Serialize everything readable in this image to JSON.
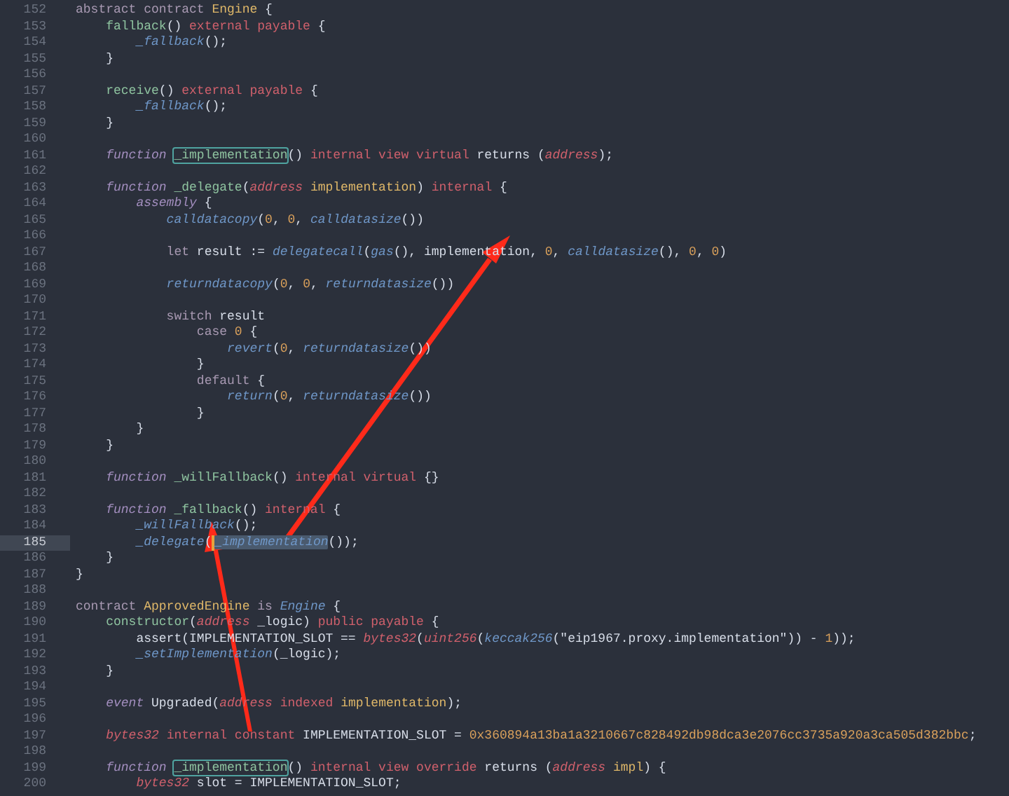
{
  "editor": {
    "lines": [
      {
        "number": "152",
        "current": false,
        "segments": [
          {
            "text": "abstract contract ",
            "kind": "control"
          },
          {
            "text": "Engine",
            "kind": "type"
          },
          {
            "text": " {",
            "kind": "plain"
          }
        ]
      },
      {
        "number": "153",
        "current": false,
        "segments": [
          {
            "text": "    fallback",
            "kind": "function"
          },
          {
            "text": "() ",
            "kind": "plain"
          },
          {
            "text": "external payable",
            "kind": "modifier"
          },
          {
            "text": " {",
            "kind": "plain"
          }
        ]
      },
      {
        "number": "154",
        "current": false,
        "segments": [
          {
            "text": "        _fallback",
            "kind": "call"
          },
          {
            "text": "();",
            "kind": "plain"
          }
        ]
      },
      {
        "number": "155",
        "current": false,
        "segments": [
          {
            "text": "    }",
            "kind": "plain"
          }
        ]
      },
      {
        "number": "156",
        "current": false
      },
      {
        "number": "157",
        "current": false,
        "segments": [
          {
            "text": "    receive",
            "kind": "function"
          },
          {
            "text": "() ",
            "kind": "plain"
          },
          {
            "text": "external payable",
            "kind": "modifier"
          },
          {
            "text": " {",
            "kind": "plain"
          }
        ]
      },
      {
        "number": "158",
        "current": false,
        "segments": [
          {
            "text": "        _fallback",
            "kind": "call"
          },
          {
            "text": "();",
            "kind": "plain"
          }
        ]
      },
      {
        "number": "159",
        "current": false,
        "segments": [
          {
            "text": "    }",
            "kind": "plain"
          }
        ]
      },
      {
        "number": "160",
        "current": false
      },
      {
        "number": "161",
        "current": false,
        "segments": [
          {
            "text": "    function ",
            "kind": "storage"
          },
          {
            "text": "_implementation",
            "kind": "boxed-function"
          },
          {
            "text": "() ",
            "kind": "plain"
          },
          {
            "text": "internal view virtual",
            "kind": "modifier"
          },
          {
            "text": " returns (",
            "kind": "plain"
          },
          {
            "text": "address",
            "kind": "type-italic"
          },
          {
            "text": ");",
            "kind": "plain"
          }
        ]
      },
      {
        "number": "162",
        "current": false
      },
      {
        "number": "163",
        "current": false,
        "segments": [
          {
            "text": "    function ",
            "kind": "storage"
          },
          {
            "text": "_delegate",
            "kind": "function"
          },
          {
            "text": "(",
            "kind": "plain"
          },
          {
            "text": "address ",
            "kind": "type-italic"
          },
          {
            "text": "implementation",
            "kind": "param"
          },
          {
            "text": ") ",
            "kind": "plain"
          },
          {
            "text": "internal",
            "kind": "modifier"
          },
          {
            "text": " {",
            "kind": "plain"
          }
        ]
      },
      {
        "number": "164",
        "current": false,
        "segments": [
          {
            "text": "        assembly",
            "kind": "storage"
          },
          {
            "text": " {",
            "kind": "plain"
          }
        ]
      },
      {
        "number": "165",
        "current": false,
        "segments": [
          {
            "text": "            calldatacopy",
            "kind": "call"
          },
          {
            "text": "(",
            "kind": "plain"
          },
          {
            "text": "0",
            "kind": "number"
          },
          {
            "text": ", ",
            "kind": "plain"
          },
          {
            "text": "0",
            "kind": "number"
          },
          {
            "text": ", ",
            "kind": "plain"
          },
          {
            "text": "calldatasize",
            "kind": "call"
          },
          {
            "text": "())",
            "kind": "plain"
          }
        ]
      },
      {
        "number": "166",
        "current": false
      },
      {
        "number": "167",
        "current": false,
        "segments": [
          {
            "text": "            let",
            "kind": "control"
          },
          {
            "text": " result := ",
            "kind": "plain"
          },
          {
            "text": "delegatecall",
            "kind": "call"
          },
          {
            "text": "(",
            "kind": "plain"
          },
          {
            "text": "gas",
            "kind": "call"
          },
          {
            "text": "(), implementation, ",
            "kind": "plain"
          },
          {
            "text": "0",
            "kind": "number"
          },
          {
            "text": ", ",
            "kind": "plain"
          },
          {
            "text": "calldatasize",
            "kind": "call"
          },
          {
            "text": "(), ",
            "kind": "plain"
          },
          {
            "text": "0",
            "kind": "number"
          },
          {
            "text": ", ",
            "kind": "plain"
          },
          {
            "text": "0",
            "kind": "number"
          },
          {
            "text": ")",
            "kind": "plain"
          }
        ]
      },
      {
        "number": "168",
        "current": false
      },
      {
        "number": "169",
        "current": false,
        "segments": [
          {
            "text": "            returndatacopy",
            "kind": "call"
          },
          {
            "text": "(",
            "kind": "plain"
          },
          {
            "text": "0",
            "kind": "number"
          },
          {
            "text": ", ",
            "kind": "plain"
          },
          {
            "text": "0",
            "kind": "number"
          },
          {
            "text": ", ",
            "kind": "plain"
          },
          {
            "text": "returndatasize",
            "kind": "call"
          },
          {
            "text": "())",
            "kind": "plain"
          }
        ]
      },
      {
        "number": "170",
        "current": false
      },
      {
        "number": "171",
        "current": false,
        "segments": [
          {
            "text": "            switch",
            "kind": "control"
          },
          {
            "text": " result",
            "kind": "plain"
          }
        ]
      },
      {
        "number": "172",
        "current": false,
        "segments": [
          {
            "text": "                case ",
            "kind": "control"
          },
          {
            "text": "0",
            "kind": "number"
          },
          {
            "text": " {",
            "kind": "plain"
          }
        ]
      },
      {
        "number": "173",
        "current": false,
        "segments": [
          {
            "text": "                    revert",
            "kind": "call"
          },
          {
            "text": "(",
            "kind": "plain"
          },
          {
            "text": "0",
            "kind": "number"
          },
          {
            "text": ", ",
            "kind": "plain"
          },
          {
            "text": "returndatasize",
            "kind": "call"
          },
          {
            "text": "())",
            "kind": "plain"
          }
        ]
      },
      {
        "number": "174",
        "current": false,
        "segments": [
          {
            "text": "                }",
            "kind": "plain"
          }
        ]
      },
      {
        "number": "175",
        "current": false,
        "segments": [
          {
            "text": "                default",
            "kind": "control"
          },
          {
            "text": " {",
            "kind": "plain"
          }
        ]
      },
      {
        "number": "176",
        "current": false,
        "segments": [
          {
            "text": "                    return",
            "kind": "call"
          },
          {
            "text": "(",
            "kind": "plain"
          },
          {
            "text": "0",
            "kind": "number"
          },
          {
            "text": ", ",
            "kind": "plain"
          },
          {
            "text": "returndatasize",
            "kind": "call"
          },
          {
            "text": "())",
            "kind": "plain"
          }
        ]
      },
      {
        "number": "177",
        "current": false,
        "segments": [
          {
            "text": "                }",
            "kind": "plain"
          }
        ]
      },
      {
        "number": "178",
        "current": false,
        "segments": [
          {
            "text": "        }",
            "kind": "plain"
          }
        ]
      },
      {
        "number": "179",
        "current": false,
        "segments": [
          {
            "text": "    }",
            "kind": "plain"
          }
        ]
      },
      {
        "number": "180",
        "current": false
      },
      {
        "number": "181",
        "current": false,
        "segments": [
          {
            "text": "    function ",
            "kind": "storage"
          },
          {
            "text": "_willFallback",
            "kind": "function"
          },
          {
            "text": "() ",
            "kind": "plain"
          },
          {
            "text": "internal virtual",
            "kind": "modifier"
          },
          {
            "text": " {}",
            "kind": "plain"
          }
        ]
      },
      {
        "number": "182",
        "current": false
      },
      {
        "number": "183",
        "current": false,
        "segments": [
          {
            "text": "    function ",
            "kind": "storage"
          },
          {
            "text": "_fallback",
            "kind": "function"
          },
          {
            "text": "() ",
            "kind": "plain"
          },
          {
            "text": "internal",
            "kind": "modifier"
          },
          {
            "text": " {",
            "kind": "plain"
          }
        ]
      },
      {
        "number": "184",
        "current": false,
        "segments": [
          {
            "text": "        _willFallback",
            "kind": "call"
          },
          {
            "text": "();",
            "kind": "plain"
          }
        ]
      },
      {
        "number": "185",
        "current": true,
        "segments": [
          {
            "text": "        _delegate",
            "kind": "call"
          },
          {
            "text": "(",
            "kind": "plain"
          },
          {
            "kind": "caret"
          },
          {
            "text": "_implementation",
            "kind": "matched-call"
          },
          {
            "text": "());",
            "kind": "plain"
          }
        ]
      },
      {
        "number": "186",
        "current": false,
        "segments": [
          {
            "text": "    }",
            "kind": "plain"
          }
        ]
      },
      {
        "number": "187",
        "current": false,
        "segments": [
          {
            "text": "}",
            "kind": "plain"
          }
        ]
      },
      {
        "number": "188",
        "current": false
      },
      {
        "number": "189",
        "current": false,
        "segments": [
          {
            "text": "contract ",
            "kind": "control"
          },
          {
            "text": "ApprovedEngine",
            "kind": "type"
          },
          {
            "text": " is ",
            "kind": "control"
          },
          {
            "text": "Engine",
            "kind": "call"
          },
          {
            "text": " {",
            "kind": "plain"
          }
        ]
      },
      {
        "number": "190",
        "current": false,
        "segments": [
          {
            "text": "    constructor",
            "kind": "function"
          },
          {
            "text": "(",
            "kind": "plain"
          },
          {
            "text": "address",
            "kind": "type-italic"
          },
          {
            "text": " _logic) ",
            "kind": "plain"
          },
          {
            "text": "public payable",
            "kind": "modifier"
          },
          {
            "text": " {",
            "kind": "plain"
          }
        ]
      },
      {
        "number": "191",
        "current": false,
        "segments": [
          {
            "text": "        assert(IMPLEMENTATION_SLOT == ",
            "kind": "plain"
          },
          {
            "text": "bytes32",
            "kind": "type-italic"
          },
          {
            "text": "(",
            "kind": "plain"
          },
          {
            "text": "uint256",
            "kind": "type-italic"
          },
          {
            "text": "(",
            "kind": "plain"
          },
          {
            "text": "keccak256",
            "kind": "call"
          },
          {
            "text": "(\"eip1967.proxy.implementation\")) - ",
            "kind": "plain"
          },
          {
            "text": "1",
            "kind": "number"
          },
          {
            "text": "));",
            "kind": "plain"
          }
        ]
      },
      {
        "number": "192",
        "current": false,
        "segments": [
          {
            "text": "        _setImplementation",
            "kind": "call"
          },
          {
            "text": "(_logic);",
            "kind": "plain"
          }
        ]
      },
      {
        "number": "193",
        "current": false,
        "segments": [
          {
            "text": "    }",
            "kind": "plain"
          }
        ]
      },
      {
        "number": "194",
        "current": false
      },
      {
        "number": "195",
        "current": false,
        "segments": [
          {
            "text": "    event",
            "kind": "storage"
          },
          {
            "text": " Upgraded(",
            "kind": "plain"
          },
          {
            "text": "address ",
            "kind": "type-italic"
          },
          {
            "text": "indexed ",
            "kind": "modifier"
          },
          {
            "text": "implementation",
            "kind": "param"
          },
          {
            "text": ");",
            "kind": "plain"
          }
        ]
      },
      {
        "number": "196",
        "current": false
      },
      {
        "number": "197",
        "current": false,
        "segments": [
          {
            "text": "    bytes32 ",
            "kind": "type-italic"
          },
          {
            "text": "internal constant",
            "kind": "modifier"
          },
          {
            "text": " IMPLEMENTATION_SLOT = ",
            "kind": "plain"
          },
          {
            "text": "0x360894a13ba1a3210667c828492db98dca3e2076cc3735a920a3ca505d382bbc",
            "kind": "number"
          },
          {
            "text": ";",
            "kind": "plain"
          }
        ]
      },
      {
        "number": "198",
        "current": false
      },
      {
        "number": "199",
        "current": false,
        "segments": [
          {
            "text": "    function ",
            "kind": "storage"
          },
          {
            "text": "_implementation",
            "kind": "boxed-function"
          },
          {
            "text": "() ",
            "kind": "plain"
          },
          {
            "text": "internal view override",
            "kind": "modifier"
          },
          {
            "text": " returns (",
            "kind": "plain"
          },
          {
            "text": "address ",
            "kind": "type-italic"
          },
          {
            "text": "impl",
            "kind": "param"
          },
          {
            "text": ") {",
            "kind": "plain"
          }
        ]
      },
      {
        "number": "200",
        "current": false,
        "segments": [
          {
            "text": "        bytes32",
            "kind": "type-italic"
          },
          {
            "text": " slot = IMPLEMENTATION_SLOT;",
            "kind": "plain"
          }
        ]
      }
    ]
  }
}
